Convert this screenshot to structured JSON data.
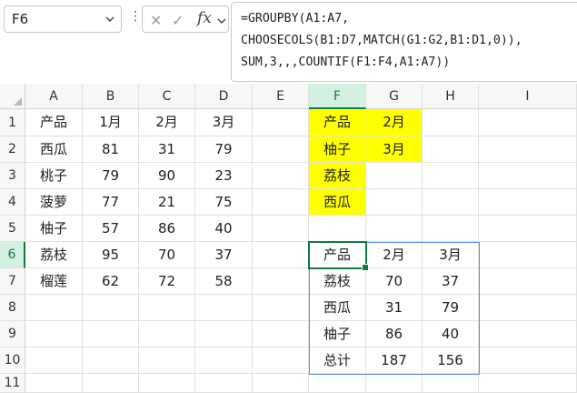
{
  "name_box": {
    "value": "F6"
  },
  "formula_bar": {
    "fx_label": "fx",
    "lines": [
      "=GROUPBY(A1:A7,",
      "CHOOSECOLS(B1:D7,MATCH(G1:G2,B1:D1,0)),",
      "SUM,3,,,COUNTIF(F1:F4,A1:A7))"
    ]
  },
  "columns": [
    "A",
    "B",
    "C",
    "D",
    "E",
    "F",
    "G",
    "H",
    "I"
  ],
  "selected_column": "F",
  "rows": [
    "1",
    "2",
    "3",
    "4",
    "5",
    "6",
    "7",
    "8",
    "9",
    "10",
    "11"
  ],
  "selected_row": "6",
  "cells": {
    "A1": "产品",
    "B1": "1月",
    "C1": "2月",
    "D1": "3月",
    "A2": "西瓜",
    "B2": "81",
    "C2": "31",
    "D2": "79",
    "A3": "桃子",
    "B3": "79",
    "C3": "90",
    "D3": "23",
    "A4": "菠萝",
    "B4": "77",
    "C4": "21",
    "D4": "75",
    "A5": "柚子",
    "B5": "57",
    "C5": "86",
    "D5": "40",
    "A6": "荔枝",
    "B6": "95",
    "C6": "70",
    "D6": "37",
    "A7": "榴莲",
    "B7": "62",
    "C7": "72",
    "D7": "58",
    "F1": "产品",
    "G1": "2月",
    "F2": "柚子",
    "G2": "3月",
    "F3": "荔枝",
    "F4": "西瓜",
    "F6": "产品",
    "G6": "2月",
    "H6": "3月",
    "F7": "荔枝",
    "G7": "70",
    "H7": "37",
    "F8": "西瓜",
    "G8": "31",
    "H8": "79",
    "F9": "柚子",
    "G9": "86",
    "H9": "40",
    "F10": "总计",
    "G10": "187",
    "H10": "156"
  },
  "highlight_color": "#ffff00",
  "selection_color": "#107c41",
  "spill_border_color": "#5a8fd6"
}
